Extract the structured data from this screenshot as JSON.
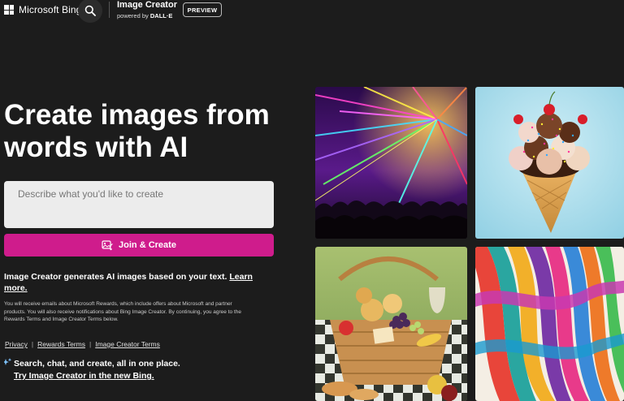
{
  "header": {
    "brand": "Microsoft Bing",
    "product_title": "Image Creator",
    "product_sub_prefix": "powered by ",
    "product_sub_brand": "DALL·E",
    "preview_badge": "PREVIEW"
  },
  "hero": {
    "title": "Create images from words with AI",
    "prompt_placeholder": "Describe what you'd like to create",
    "join_label": "Join & Create"
  },
  "info": {
    "description": "Image Creator generates AI images based on your text.",
    "learn_more": "Learn more.",
    "legal": "You will receive emails about Microsoft Rewards, which include offers about Microsoft and partner products. You will also receive notifications about Bing Image Creator. By continuing, you agree to the Rewards Terms and Image Creator Terms below."
  },
  "links": {
    "privacy": "Privacy",
    "rewards_terms": "Rewards Terms",
    "image_creator_terms": "Image Creator Terms",
    "separator": "|"
  },
  "promo": {
    "text": "Search, chat, and create, all in one place.",
    "link": "Try Image Creator in the new Bing."
  },
  "icons": {
    "search": "search-icon",
    "join": "image-create-icon",
    "promo": "sparkle-icon"
  },
  "colors": {
    "background": "#1c1c1c",
    "accent": "#cf1c8c",
    "input_bg": "#ececec"
  }
}
